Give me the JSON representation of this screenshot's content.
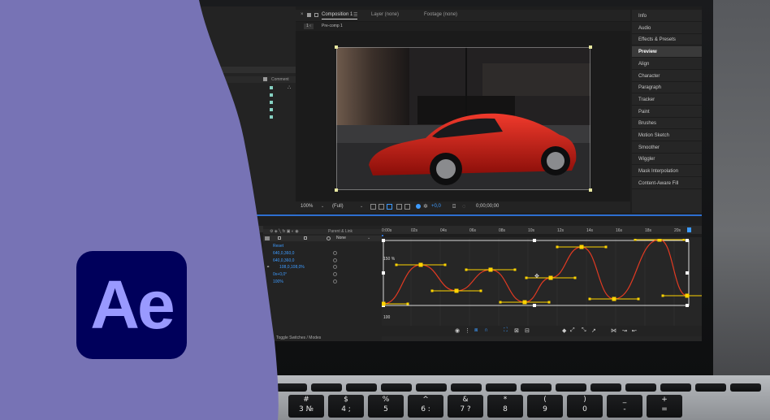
{
  "composition_panel": {
    "tabs": [
      {
        "label": "Composition 1",
        "active": true
      },
      {
        "label": "Layer (none)",
        "active": false
      },
      {
        "label": "Footage (none)",
        "active": false
      }
    ],
    "sub_tab": "Pre-comp 1",
    "bottom_bar": {
      "zoom": "100%",
      "resolution": "(Full)",
      "exposure": "+0,0",
      "timecode": "0;00;00;00"
    }
  },
  "project_panel": {
    "comment_header": "Comment"
  },
  "right_panel": {
    "items": [
      {
        "label": "Info",
        "active": false
      },
      {
        "label": "Audio",
        "active": false
      },
      {
        "label": "Effects & Presets",
        "active": false
      },
      {
        "label": "Preview",
        "active": true
      },
      {
        "label": "Align",
        "active": false
      },
      {
        "label": "Character",
        "active": false
      },
      {
        "label": "Paragraph",
        "active": false
      },
      {
        "label": "Tracker",
        "active": false
      },
      {
        "label": "Paint",
        "active": false
      },
      {
        "label": "Brushes",
        "active": false
      },
      {
        "label": "Motion Sketch",
        "active": false
      },
      {
        "label": "Smoother",
        "active": false
      },
      {
        "label": "Wiggler",
        "active": false
      },
      {
        "label": "Mask Interpolation",
        "active": false
      },
      {
        "label": "Content-Aware Fill",
        "active": false
      }
    ]
  },
  "timeline": {
    "parent_link_header": "Parent & Link",
    "parent_value": "None",
    "properties": [
      {
        "value": "Reset"
      },
      {
        "value": "640,0,360,0"
      },
      {
        "value": "640,0,360,0"
      },
      {
        "value": "108,0,108,0%"
      },
      {
        "value": "0x+0,0°"
      },
      {
        "value": "100%"
      }
    ],
    "ruler_labels": [
      "0:00s",
      "02s",
      "04s",
      "06s",
      "08s",
      "10s",
      "12s",
      "14s",
      "16s",
      "18s",
      "20s"
    ],
    "graph_max_label": "150 %",
    "graph_min_label": "100",
    "footer_label": "Toggle Switches / Modes"
  },
  "logo": {
    "text": "Ae",
    "background_color": "#00005b",
    "text_color": "#9999ff",
    "wave_color": "#7773b5"
  },
  "keyboard": {
    "keys": [
      "#\n3 №",
      "$\n4 ;",
      "%\n5",
      "^\n6 :",
      "&\n7 ?",
      "*\n8",
      "(\n9",
      ")\n0",
      "_\n-",
      "+\n="
    ]
  },
  "colors": {
    "accent_blue": "#2d6fd0",
    "keyframe_yellow": "#ffd400",
    "curve_red": "#e23a22",
    "property_blue": "#3d9bff"
  }
}
